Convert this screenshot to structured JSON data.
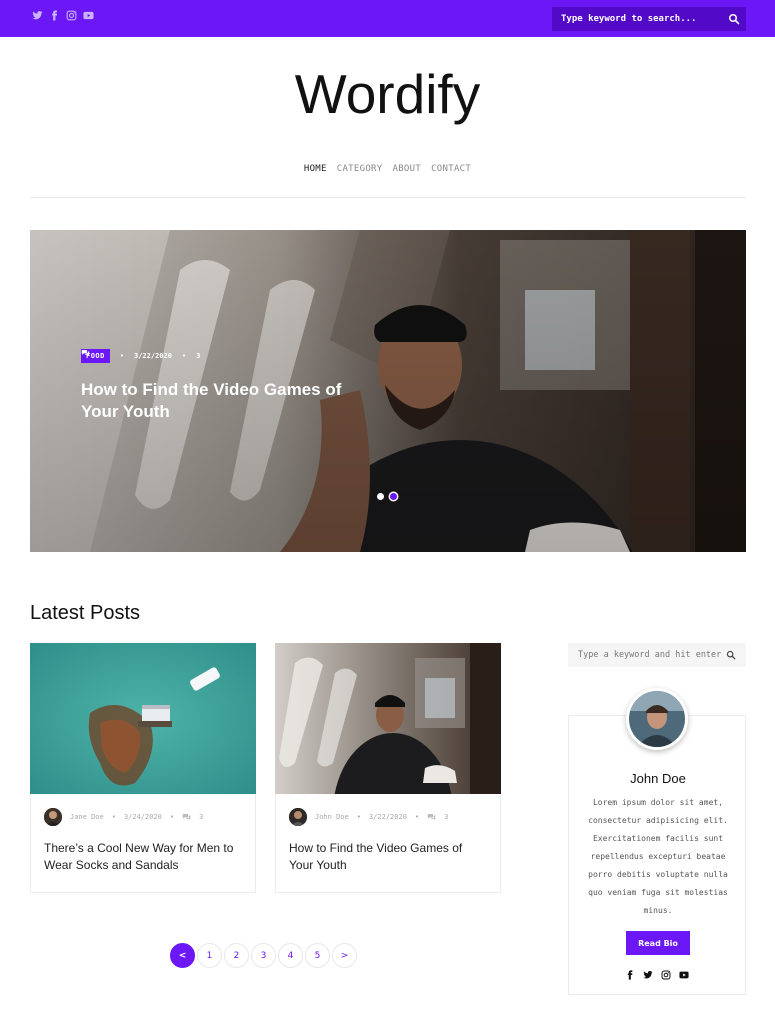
{
  "topbar": {
    "social_icons": [
      "twitter-icon",
      "facebook-icon",
      "instagram-icon",
      "youtube-icon"
    ],
    "search_placeholder": "Type keyword to search...",
    "accent": "#6c17f5"
  },
  "site": {
    "logo": "Wordify"
  },
  "nav": {
    "items": [
      "HOME",
      "CATEGORY",
      "ABOUT",
      "CONTACT"
    ]
  },
  "hero": {
    "category": "FOOD",
    "date": "3/22/2020",
    "comments": "3",
    "title": "How to Find the Video Games of Your Youth",
    "slide_count": 2,
    "active_slide": 2
  },
  "latest": {
    "title": "Latest Posts",
    "posts": [
      {
        "author": "Jane Doe",
        "date": "3/24/2020",
        "comments": "3",
        "title": "There’s a Cool New Way for Men to Wear Socks and Sandals"
      },
      {
        "author": "John Doe",
        "date": "3/22/2020",
        "comments": "3",
        "title": "How to Find the Video Games of Your Youth"
      }
    ]
  },
  "pagination": {
    "prev": "<",
    "pages": [
      "1",
      "2",
      "3",
      "4",
      "5"
    ],
    "next": ">"
  },
  "sidebar": {
    "search_placeholder": "Type a keyword and hit enter",
    "bio": {
      "name": "John Doe",
      "text": "Lorem ipsum dolor sit amet, consectetur adipisicing elit. Exercitationem facilis sunt repellendus excepturi beatae porro debitis voluptate nulla quo veniam fuga sit molestias minus.",
      "button": "Read Bio",
      "social_icons": [
        "facebook-icon",
        "twitter-icon",
        "instagram-icon",
        "youtube-icon"
      ]
    }
  }
}
